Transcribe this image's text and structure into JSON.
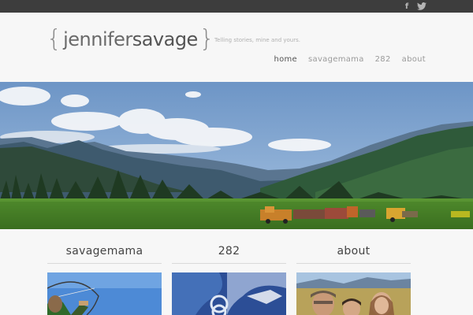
{
  "topbar": {
    "facebook_icon": "facebook-icon",
    "facebook_glyph": "f",
    "twitter_icon": "twitter-icon"
  },
  "header": {
    "logo": {
      "open_brace": "{",
      "first": "jennifer",
      "last": "savage",
      "close_brace": "}"
    },
    "tagline": "Telling stories, mine and yours."
  },
  "nav": {
    "items": [
      {
        "label": "home",
        "active": true
      },
      {
        "label": "savagemama",
        "active": false
      },
      {
        "label": "282",
        "active": false
      },
      {
        "label": "about",
        "active": false
      }
    ]
  },
  "hero": {
    "image": "mountain-meadow-with-old-trucks-photo"
  },
  "columns": [
    {
      "title": "savagemama",
      "image": "archery-photo"
    },
    {
      "title": "282",
      "image": "blue-graphic-282-photo"
    },
    {
      "title": "about",
      "image": "family-portrait-photo"
    }
  ],
  "colors": {
    "topbar": "#3d3d3d",
    "header_bg": "#f7f7f7",
    "nav_active": "#555555",
    "nav_inactive": "#9a9a9a"
  }
}
